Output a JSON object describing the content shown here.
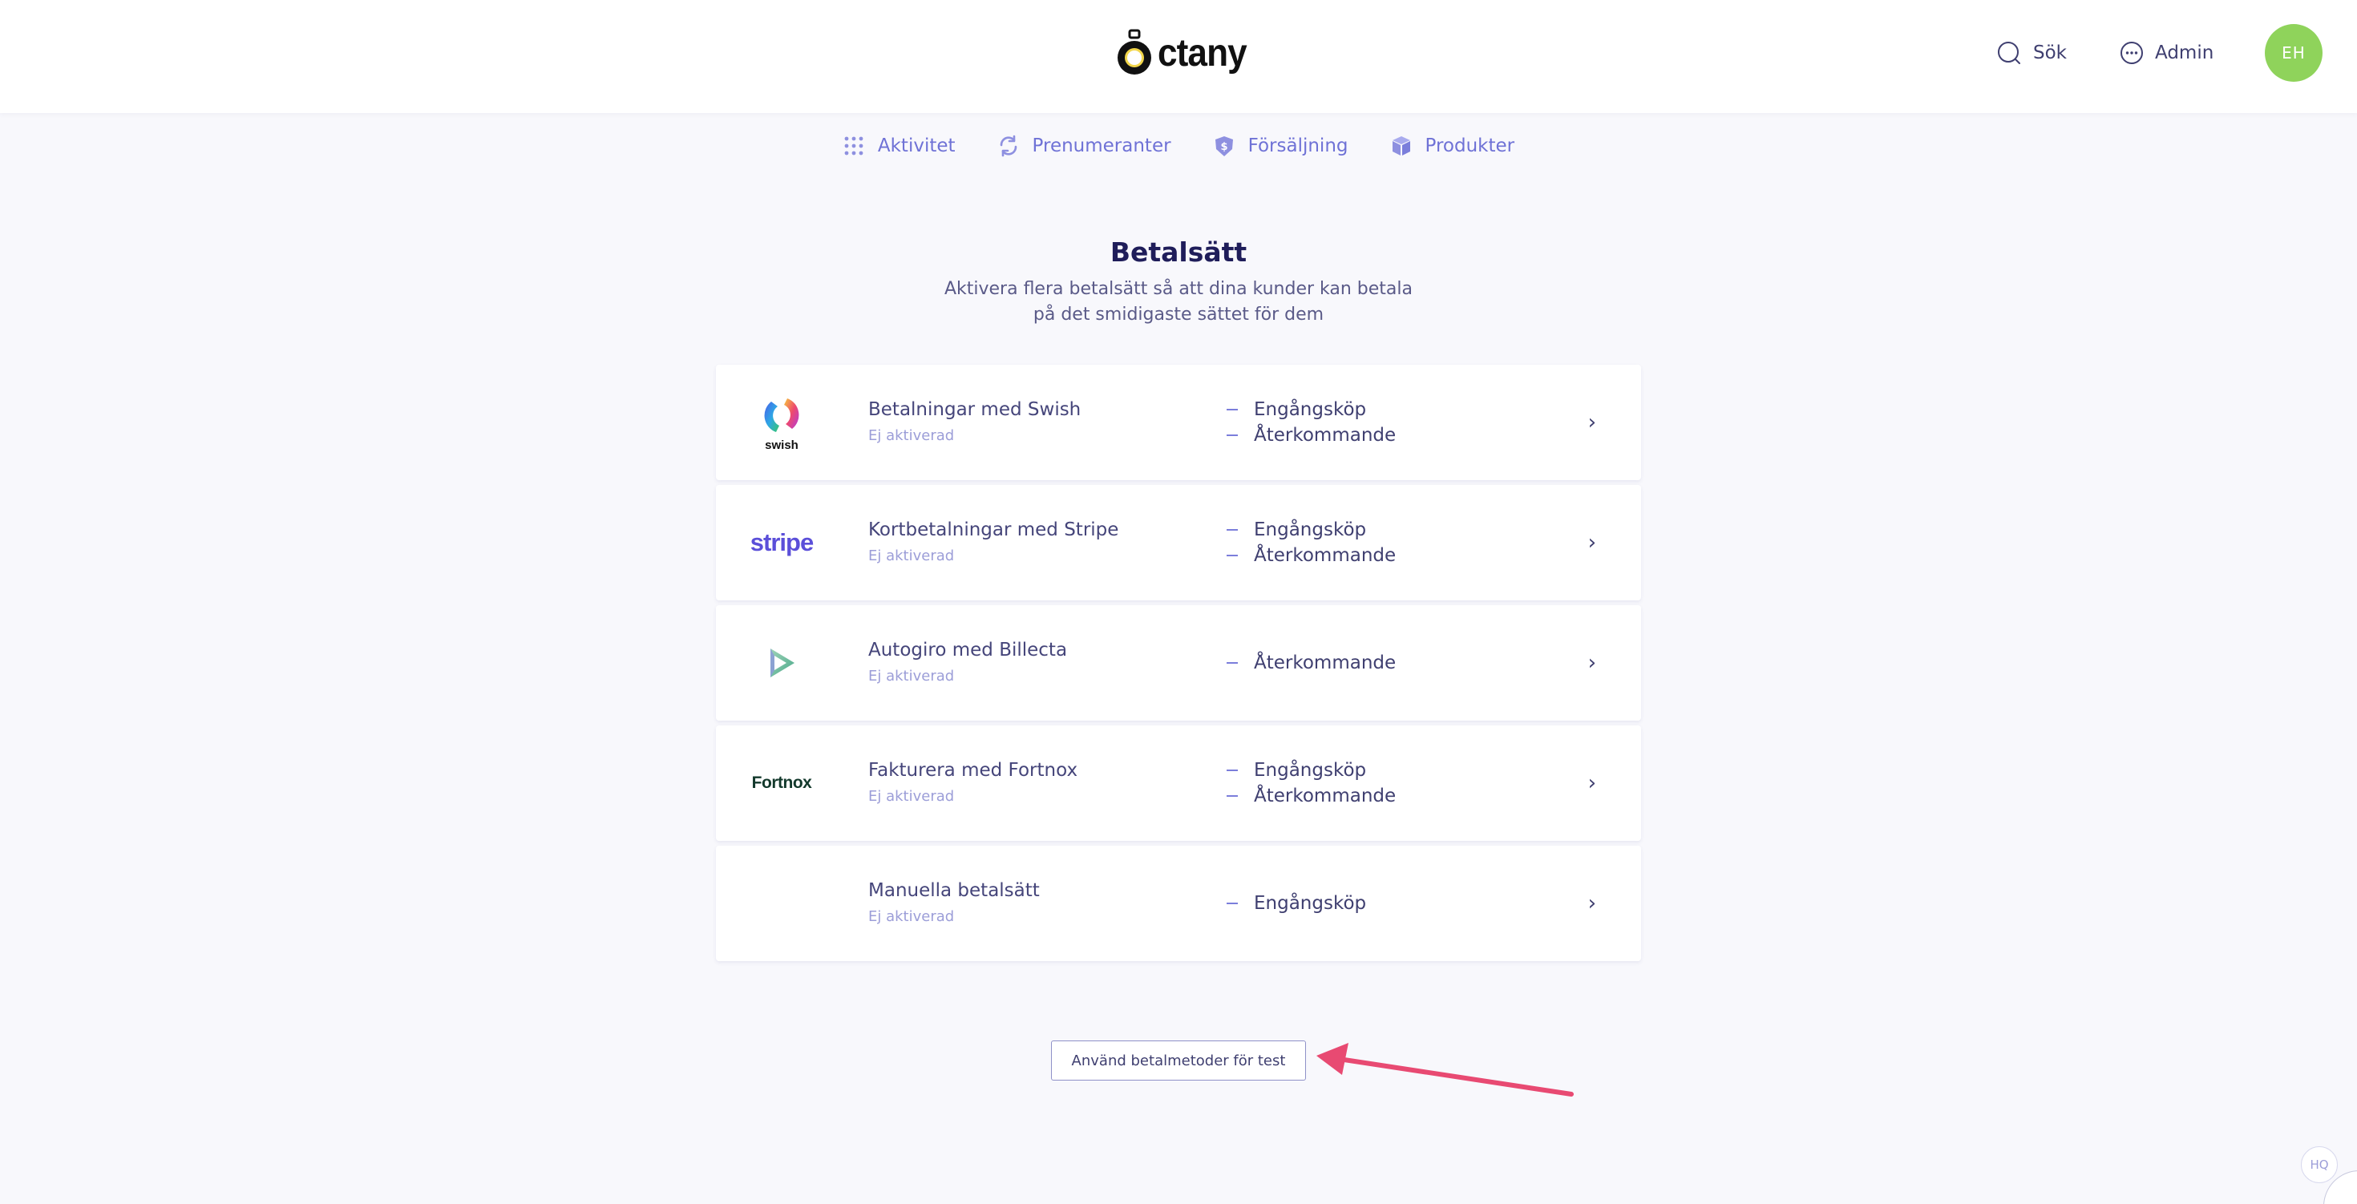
{
  "header": {
    "logo_text": "ctany",
    "search_label": "Sök",
    "admin_label": "Admin",
    "avatar_initials": "EH",
    "avatar_color": "#8fd35b"
  },
  "nav": {
    "items": [
      {
        "label": "Aktivitet",
        "icon": "grid-dots-icon"
      },
      {
        "label": "Prenumeranter",
        "icon": "refresh-icon"
      },
      {
        "label": "Försäljning",
        "icon": "money-shield-icon"
      },
      {
        "label": "Produkter",
        "icon": "box-icon"
      }
    ],
    "accent_color": "#6f72d6"
  },
  "page": {
    "title": "Betalsätt",
    "subtitle": "Aktivera flera betalsätt så att dina kunder kan betala på det smidigaste sättet för dem"
  },
  "methods": [
    {
      "logo": "swish-logo",
      "logo_text": "swish",
      "name": "Betalningar med Swish",
      "status": "Ej aktiverad",
      "types": [
        "Engångsköp",
        "Återkommande"
      ]
    },
    {
      "logo": "stripe-logo",
      "logo_text": "stripe",
      "name": "Kortbetalningar med Stripe",
      "status": "Ej aktiverad",
      "types": [
        "Engångsköp",
        "Återkommande"
      ]
    },
    {
      "logo": "billecta-logo",
      "name": "Autogiro med Billecta",
      "status": "Ej aktiverad",
      "types": [
        "Återkommande"
      ]
    },
    {
      "logo": "fortnox-logo",
      "logo_text": "Fortnox",
      "name": "Fakturera med Fortnox",
      "status": "Ej aktiverad",
      "types": [
        "Engångsköp",
        "Återkommande"
      ]
    },
    {
      "logo": "none",
      "name": "Manuella betalsätt",
      "status": "Ej aktiverad",
      "types": [
        "Engångsköp"
      ]
    }
  ],
  "test_button": {
    "label": "Använd betalmetoder för test"
  },
  "annotation": {
    "arrow_color": "#e84a72"
  },
  "support_widget": {
    "label": "HQ"
  }
}
